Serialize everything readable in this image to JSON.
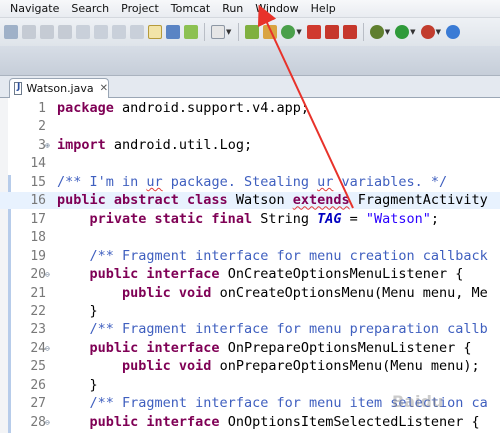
{
  "menu": {
    "items": [
      "Navigate",
      "Search",
      "Project",
      "Tomcat",
      "Run",
      "Window",
      "Help"
    ]
  },
  "toolbar": {
    "icons": [
      "debug-icon",
      "suspend-icon",
      "terminate-icon",
      "disconnect-icon",
      "step-into-icon",
      "step-over-icon",
      "step-return-icon",
      "drop-to-frame-icon",
      "use-step-filters-icon",
      "open-console-icon",
      "android-sdk-manager-icon",
      "avd-manager-icon",
      "new-android-project-icon",
      "open-type-icon",
      "web-icon",
      "server-icon",
      "run-icon",
      "coverage-icon",
      "external-tools-icon"
    ]
  },
  "editor": {
    "tab_label": "Watson.java",
    "lines": [
      {
        "num": "1",
        "html_tokens": [
          [
            "kw",
            "package"
          ],
          [
            "",
            " android.support.v4.app;"
          ]
        ]
      },
      {
        "num": "2",
        "html_tokens": []
      },
      {
        "num": "3",
        "html_tokens": [
          [
            "kw",
            "import"
          ],
          [
            "",
            " android.util.Log;"
          ]
        ],
        "fold": "⊕"
      },
      {
        "num": "14",
        "html_tokens": []
      },
      {
        "num": "15",
        "html_tokens": [
          [
            "cm",
            "/** I'm in "
          ],
          [
            "cm squig",
            "ur"
          ],
          [
            "cm",
            " package. Stealing "
          ],
          [
            "cm squig",
            "ur"
          ],
          [
            "cm",
            " variables. */"
          ]
        ]
      },
      {
        "num": "16",
        "html_tokens": [
          [
            "kw",
            "public abstract class"
          ],
          [
            "",
            " Watson "
          ],
          [
            "kw squig",
            "extends"
          ],
          [
            "",
            " FragmentActivity"
          ]
        ],
        "current": true
      },
      {
        "num": "17",
        "html_tokens": [
          [
            "",
            "    "
          ],
          [
            "kw",
            "private static final"
          ],
          [
            "",
            " String "
          ],
          [
            "const",
            "TAG"
          ],
          [
            "",
            " = "
          ],
          [
            "str",
            "\"Watson\""
          ],
          [
            "",
            ";"
          ]
        ]
      },
      {
        "num": "18",
        "html_tokens": []
      },
      {
        "num": "19",
        "html_tokens": [
          [
            "",
            "    "
          ],
          [
            "cm",
            "/** Fragment interface for menu creation callback"
          ]
        ]
      },
      {
        "num": "20",
        "html_tokens": [
          [
            "",
            "    "
          ],
          [
            "kw",
            "public interface"
          ],
          [
            "",
            " OnCreateOptionsMenuListener {"
          ]
        ],
        "fold": "⊖"
      },
      {
        "num": "21",
        "html_tokens": [
          [
            "",
            "        "
          ],
          [
            "kw",
            "public void"
          ],
          [
            "",
            " onCreateOptionsMenu(Menu menu, Me"
          ]
        ]
      },
      {
        "num": "22",
        "html_tokens": [
          [
            "",
            "    }"
          ]
        ]
      },
      {
        "num": "23",
        "html_tokens": [
          [
            "",
            "    "
          ],
          [
            "cm",
            "/** Fragment interface for menu preparation callb"
          ]
        ]
      },
      {
        "num": "24",
        "html_tokens": [
          [
            "",
            "    "
          ],
          [
            "kw",
            "public interface"
          ],
          [
            "",
            " OnPrepareOptionsMenuListener {"
          ]
        ],
        "fold": "⊖"
      },
      {
        "num": "25",
        "html_tokens": [
          [
            "",
            "        "
          ],
          [
            "kw",
            "public void"
          ],
          [
            "",
            " onPrepareOptionsMenu(Menu menu);"
          ]
        ]
      },
      {
        "num": "26",
        "html_tokens": [
          [
            "",
            "    }"
          ]
        ]
      },
      {
        "num": "27",
        "html_tokens": [
          [
            "",
            "    "
          ],
          [
            "cm",
            "/** Fragment interface for menu item selection ca"
          ]
        ]
      },
      {
        "num": "28",
        "html_tokens": [
          [
            "",
            "    "
          ],
          [
            "kw",
            "public interface"
          ],
          [
            "",
            " OnOptionsItemSelectedListener {"
          ]
        ],
        "fold": "⊖"
      }
    ]
  },
  "watermark": "Baidu",
  "colors": {
    "keyword": "#7f0055",
    "comment": "#3f5fbf",
    "string": "#2a00ff",
    "constant": "#0000c0",
    "arrow": "#e8322a",
    "current_line": "#e8f2fe"
  }
}
